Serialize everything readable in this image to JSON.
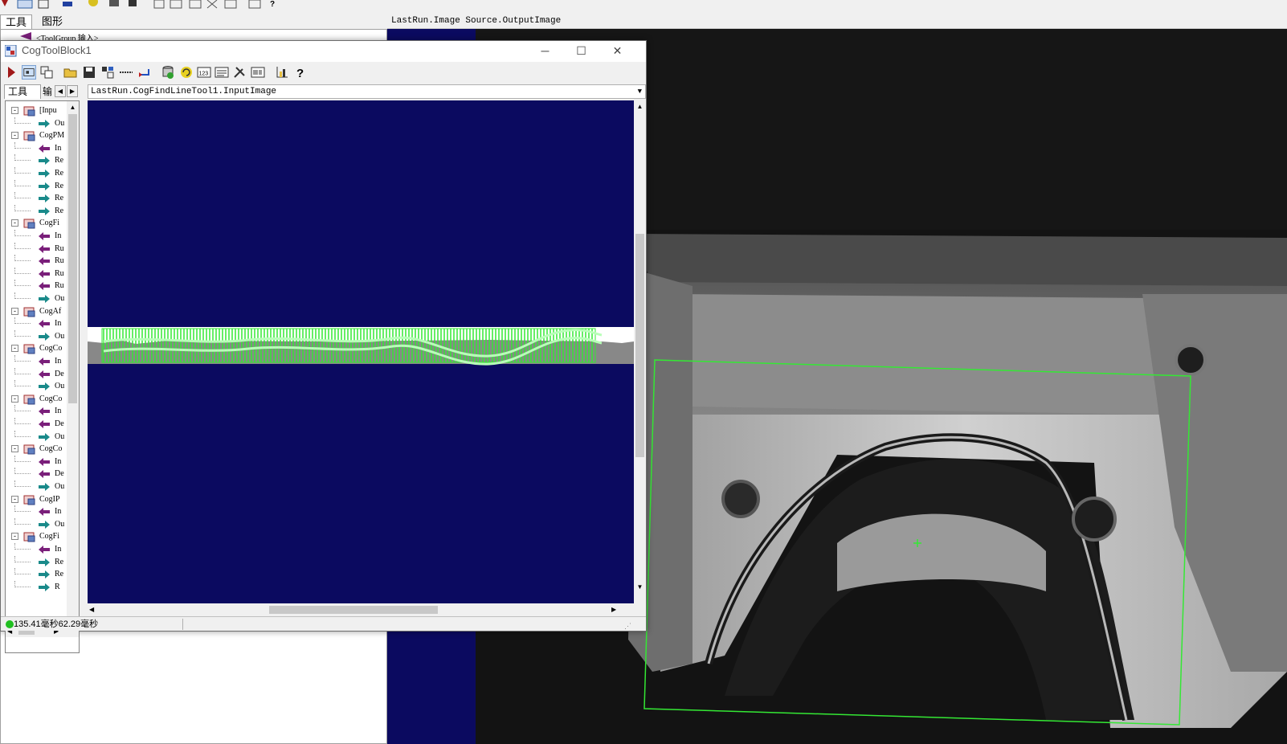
{
  "background_app": {
    "tabs": [
      "工具",
      "图形"
    ],
    "left_tree_item": "<ToolGroup 输入>",
    "right_header": "LastRun.Image Source.OutputImage"
  },
  "window": {
    "title": "CogToolBlock1",
    "minimize": "─",
    "maximize": "☐",
    "close": "✕",
    "left_tabs": [
      "工具",
      "输"
    ],
    "image_header": "LastRun.CogFindLineTool1.InputImage",
    "status_text": "135.41毫秒62.29毫秒",
    "tree": [
      {
        "type": "group",
        "label": "[Inpu"
      },
      {
        "type": "out",
        "label": "Ou"
      },
      {
        "type": "group",
        "label": "CogPM"
      },
      {
        "type": "in",
        "label": "In"
      },
      {
        "type": "out",
        "label": "Re"
      },
      {
        "type": "out",
        "label": "Re"
      },
      {
        "type": "out",
        "label": "Re"
      },
      {
        "type": "out",
        "label": "Re"
      },
      {
        "type": "out",
        "label": "Re"
      },
      {
        "type": "group",
        "label": "CogFi"
      },
      {
        "type": "in",
        "label": "In"
      },
      {
        "type": "in",
        "label": "Ru"
      },
      {
        "type": "in",
        "label": "Ru"
      },
      {
        "type": "in",
        "label": "Ru"
      },
      {
        "type": "in",
        "label": "Ru"
      },
      {
        "type": "out",
        "label": "Ou"
      },
      {
        "type": "group",
        "label": "CogAf"
      },
      {
        "type": "in",
        "label": "In"
      },
      {
        "type": "out",
        "label": "Ou"
      },
      {
        "type": "group",
        "label": "CogCo"
      },
      {
        "type": "in",
        "label": "In"
      },
      {
        "type": "in",
        "label": "De"
      },
      {
        "type": "out",
        "label": "Ou"
      },
      {
        "type": "group",
        "label": "CogCo"
      },
      {
        "type": "in",
        "label": "In"
      },
      {
        "type": "in",
        "label": "De"
      },
      {
        "type": "out",
        "label": "Ou"
      },
      {
        "type": "group",
        "label": "CogCo"
      },
      {
        "type": "in",
        "label": "In"
      },
      {
        "type": "in",
        "label": "De"
      },
      {
        "type": "out",
        "label": "Ou"
      },
      {
        "type": "group",
        "label": "CogIP"
      },
      {
        "type": "in",
        "label": "In"
      },
      {
        "type": "out",
        "label": "Ou"
      },
      {
        "type": "group",
        "label": "CogFi"
      },
      {
        "type": "in",
        "label": "In"
      },
      {
        "type": "out",
        "label": "Re"
      },
      {
        "type": "out",
        "label": "Re"
      },
      {
        "type": "out",
        "label": "R"
      }
    ]
  },
  "colors": {
    "image_bg": "#0b0a60",
    "overlay_green": "#34e834",
    "in_arrow": "#7a1f7a",
    "out_arrow": "#1a8a8a",
    "status_dot": "#22c022"
  }
}
